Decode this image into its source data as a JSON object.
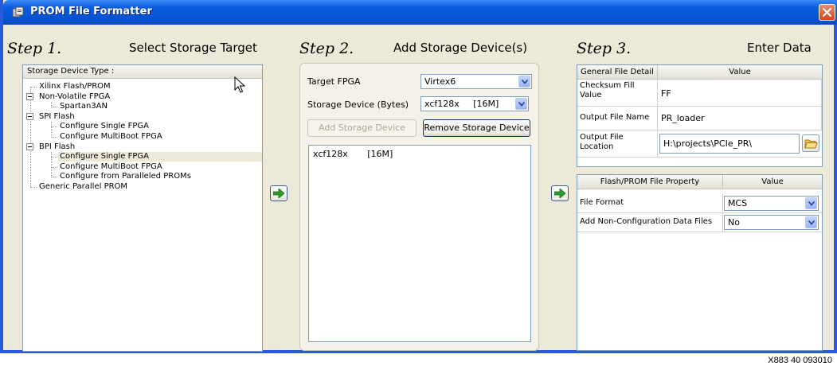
{
  "window": {
    "title": "PROM File Formatter",
    "colors": {
      "titlebar": "#0a5de0",
      "close": "#d9451e",
      "arrow": "#2e9a2e"
    }
  },
  "step1": {
    "label": "Step 1.",
    "title": "Select Storage Target",
    "tree_header": "Storage Device Type :",
    "tree": [
      {
        "label": "Xilinx Flash/PROM",
        "level": 0
      },
      {
        "label": "Non-Volatile FPGA",
        "level": 0,
        "expander": true
      },
      {
        "label": "Spartan3AN",
        "level": 1
      },
      {
        "label": "SPI Flash",
        "level": 0,
        "expander": true
      },
      {
        "label": "Configure Single FPGA",
        "level": 1
      },
      {
        "label": "Configure MultiBoot FPGA",
        "level": 1
      },
      {
        "label": "BPI Flash",
        "level": 0,
        "expander": true
      },
      {
        "label": "Configure Single FPGA",
        "level": 1,
        "selected": true
      },
      {
        "label": "Configure MultiBoot FPGA",
        "level": 1
      },
      {
        "label": "Configure from Paralleled PROMs",
        "level": 1
      },
      {
        "label": "Generic Parallel PROM",
        "level": 0
      }
    ]
  },
  "step2": {
    "label": "Step 2.",
    "title": "Add Storage Device(s)",
    "target_fpga_label": "Target FPGA",
    "target_fpga_value": "Virtex6",
    "storage_device_label": "Storage Device (Bytes)",
    "storage_device_value": "xcf128x     [16M]",
    "add_button": "Add Storage Device",
    "remove_button": "Remove Storage Device",
    "devices": [
      "xcf128x       [16M]"
    ]
  },
  "step3": {
    "label": "Step 3.",
    "title": "Enter Data",
    "general": {
      "headers": [
        "General File Detail",
        "Value"
      ],
      "rows": [
        {
          "name": "Checksum Fill Value",
          "value": "FF"
        },
        {
          "name": "Output File Name",
          "value": "PR_loader"
        },
        {
          "name": "Output File Location",
          "value": "H:\\projects\\PCIe_PR\\"
        }
      ]
    },
    "flash": {
      "headers": [
        "Flash/PROM File Property",
        "Value"
      ],
      "rows": [
        {
          "name": "File Format",
          "value": "MCS"
        },
        {
          "name": "Add Non-Configuration Data Files",
          "value": "No"
        }
      ]
    }
  },
  "footer_code": "X883  40  093010"
}
